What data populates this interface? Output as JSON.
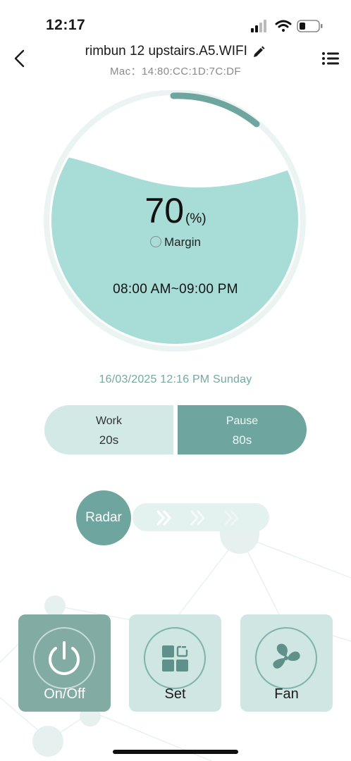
{
  "status_bar": {
    "time": "12:17",
    "icons": [
      "signal-icon",
      "wifi-icon",
      "battery-icon"
    ]
  },
  "header": {
    "title": "rimbun 12 upstairs.A5.WIFI",
    "mac": "Mac：14:80:CC:1D:7C:DF"
  },
  "gauge": {
    "percent": "70",
    "unit": "(%)",
    "fill_level": 0.7,
    "margin_label": "Margin",
    "schedule": "08:00 AM~09:00 PM"
  },
  "datetime": "16/03/2025 12:16 PM Sunday",
  "work_pause": {
    "work_label": "Work",
    "work_value": "20s",
    "pause_label": "Pause",
    "pause_value": "80s"
  },
  "radar": {
    "label": "Radar"
  },
  "buttons": {
    "onoff": "On/Off",
    "set": "Set",
    "fan": "Fan"
  },
  "colors": {
    "accent": "#6ea59e",
    "light_accent": "#d3e9e6",
    "gauge_fill": "#a8ddd7",
    "date_text": "#74a9a0"
  }
}
